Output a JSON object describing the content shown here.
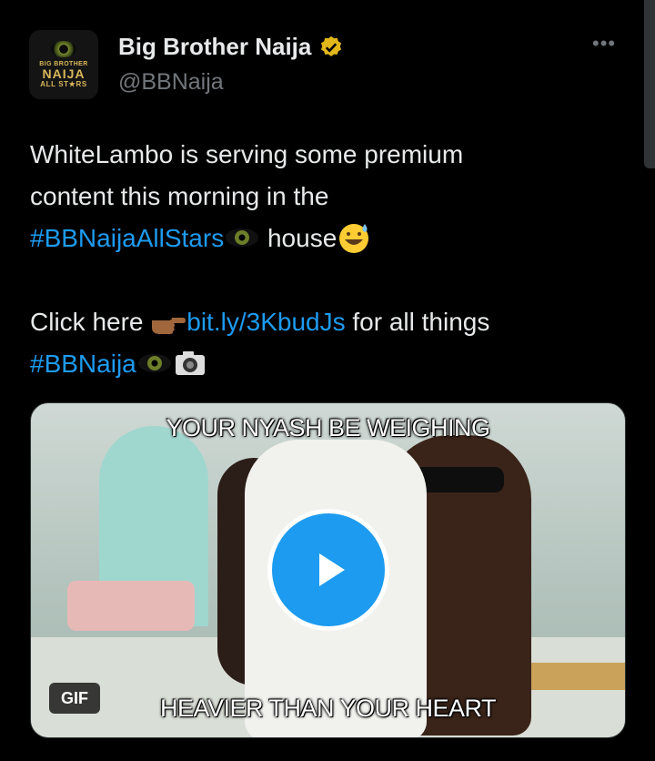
{
  "author": {
    "avatar_text": [
      "BIG BROTHER",
      "NAIJA",
      "ALL ST★RS"
    ],
    "name": "Big Brother Naija",
    "handle": "@BBNaija",
    "verified": true
  },
  "menu": {
    "more_label": "•••"
  },
  "tweet": {
    "line1": "WhiteLambo is serving some premium",
    "line2": "content this morning in the",
    "hashtag1": "#BBNaijaAllStars",
    "line3_rest": " house",
    "click_here": "Click here ",
    "link": "bit.ly/3KbudJs",
    "link_rest": " for all things",
    "hashtag2": "#BBNaija"
  },
  "media": {
    "caption_top": "YOUR NYASH BE WEIGHING",
    "caption_bottom": "HEAVIER THAN YOUR HEART",
    "badge": "GIF",
    "play_icon": "play-icon"
  },
  "colors": {
    "link": "#1d9bf0",
    "background": "#000000",
    "text": "#e7e9ea",
    "muted": "#71767b",
    "verified": "#e2b719"
  }
}
